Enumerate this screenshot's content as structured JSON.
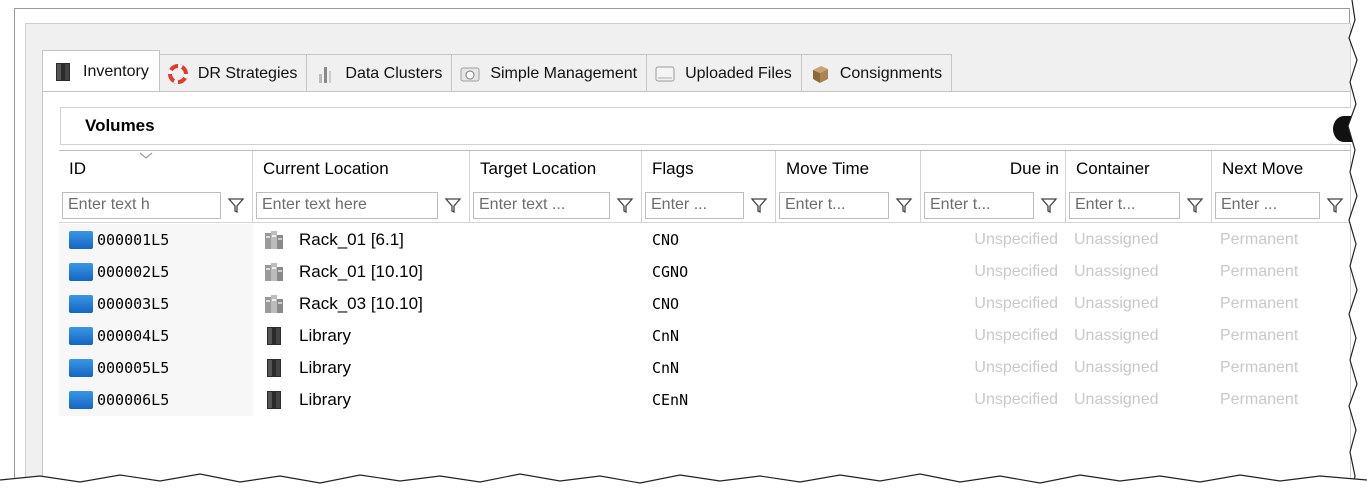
{
  "tabs": [
    {
      "label": "Inventory",
      "icon": "cabinet-icon",
      "active": true
    },
    {
      "label": "DR Strategies",
      "icon": "lifebuoy-icon",
      "active": false
    },
    {
      "label": "Data Clusters",
      "icon": "cluster-icon",
      "active": false
    },
    {
      "label": "Simple Management",
      "icon": "gauge-icon",
      "active": false
    },
    {
      "label": "Uploaded Files",
      "icon": "tray-icon",
      "active": false
    },
    {
      "label": "Consignments",
      "icon": "box-icon",
      "active": false
    }
  ],
  "section": {
    "title": "Volumes"
  },
  "grid": {
    "columns": [
      {
        "label": "ID",
        "filter_placeholder": "Enter text h"
      },
      {
        "label": "Current Location",
        "filter_placeholder": "Enter text here"
      },
      {
        "label": "Target Location",
        "filter_placeholder": "Enter text ..."
      },
      {
        "label": "Flags",
        "filter_placeholder": "Enter ..."
      },
      {
        "label": "Move Time",
        "filter_placeholder": "Enter t..."
      },
      {
        "label": "Due in",
        "filter_placeholder": "Enter t..."
      },
      {
        "label": "Container",
        "filter_placeholder": "Enter t..."
      },
      {
        "label": "Next Move",
        "filter_placeholder": "Enter ..."
      }
    ],
    "rows": [
      {
        "id": "000001L5",
        "current_location": "Rack_01 [6.1]",
        "location_icon": "rack-icon",
        "target_location": "",
        "flags": "CNO",
        "move_time": "",
        "due_in": "Unspecified",
        "container": "Unassigned",
        "next_move": "Permanent"
      },
      {
        "id": "000002L5",
        "current_location": "Rack_01 [10.10]",
        "location_icon": "rack-icon",
        "target_location": "",
        "flags": "CGNO",
        "move_time": "",
        "due_in": "Unspecified",
        "container": "Unassigned",
        "next_move": "Permanent"
      },
      {
        "id": "000003L5",
        "current_location": "Rack_03 [10.10]",
        "location_icon": "rack-icon",
        "target_location": "",
        "flags": "CNO",
        "move_time": "",
        "due_in": "Unspecified",
        "container": "Unassigned",
        "next_move": "Permanent"
      },
      {
        "id": "000004L5",
        "current_location": "Library",
        "location_icon": "library-icon",
        "target_location": "",
        "flags": "CnN",
        "move_time": "",
        "due_in": "Unspecified",
        "container": "Unassigned",
        "next_move": "Permanent"
      },
      {
        "id": "000005L5",
        "current_location": "Library",
        "location_icon": "library-icon",
        "target_location": "",
        "flags": "CnN",
        "move_time": "",
        "due_in": "Unspecified",
        "container": "Unassigned",
        "next_move": "Permanent"
      },
      {
        "id": "000006L5",
        "current_location": "Library",
        "location_icon": "library-icon",
        "target_location": "",
        "flags": "CEnN",
        "move_time": "",
        "due_in": "Unspecified",
        "container": "Unassigned",
        "next_move": "Permanent"
      }
    ]
  },
  "colors": {
    "volume_icon": "#1e88e5",
    "faded_text": "#c8c8c8",
    "panel_bg": "#f0f0f0"
  }
}
